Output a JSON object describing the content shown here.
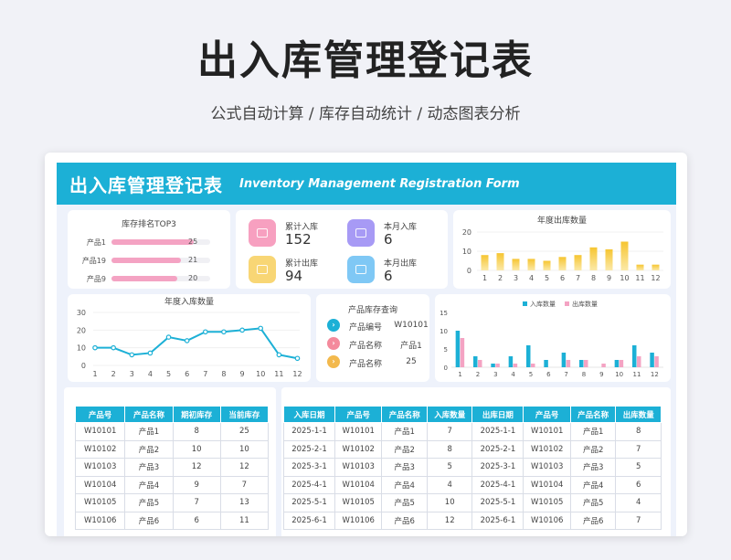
{
  "hero": {
    "title": "出入库管理登记表",
    "subtitle": "公式自动计算 /  库存自动统计  /  动态图表分析"
  },
  "banner": {
    "title_cn": "出入库管理登记表",
    "title_en": "Inventory Management Registration Form"
  },
  "colors": {
    "accent": "#1cb0d6",
    "pink": "#f4a3c3",
    "yellow": "#f6c531",
    "purple": "#a79af5",
    "blue": "#7fc8f5",
    "pink_icon": "#f7a0c0",
    "yellow_icon": "#f8d675"
  },
  "top3": {
    "title": "库存排名TOP3",
    "items": [
      {
        "label": "产品1",
        "value": 25
      },
      {
        "label": "产品19",
        "value": 21
      },
      {
        "label": "产品9",
        "value": 20
      }
    ]
  },
  "stats": {
    "total_in": {
      "label": "累计入库",
      "value": "152",
      "icon": "inbox-icon"
    },
    "month_in": {
      "label": "本月入库",
      "value": "6",
      "icon": "inbox-icon"
    },
    "total_out": {
      "label": "累计出库",
      "value": "94",
      "icon": "outbox-icon"
    },
    "month_out": {
      "label": "本月出库",
      "value": "6",
      "icon": "outbox-icon"
    }
  },
  "query": {
    "title": "产品库存查询",
    "rows": [
      {
        "label": "产品编号",
        "value": "W10101",
        "icon": "chevron-right-icon"
      },
      {
        "label": "产品名称",
        "value": "产品1",
        "icon": "chevron-right-icon"
      },
      {
        "label": "产品名称",
        "value": "25",
        "icon": "chevron-right-icon"
      }
    ]
  },
  "chart_data": [
    {
      "type": "bar",
      "title": "年度出库数量",
      "categories": [
        "1",
        "2",
        "3",
        "4",
        "5",
        "6",
        "7",
        "8",
        "9",
        "10",
        "11",
        "12"
      ],
      "values": [
        8,
        9,
        6,
        6,
        5,
        7,
        8,
        12,
        11,
        15,
        3,
        3
      ],
      "ylim": [
        0,
        20
      ],
      "yticks": [
        0,
        10,
        20
      ],
      "grid": true
    },
    {
      "type": "line",
      "title": "年度入库数量",
      "categories": [
        "1",
        "2",
        "3",
        "4",
        "5",
        "6",
        "7",
        "8",
        "9",
        "10",
        "11",
        "12"
      ],
      "values": [
        10,
        10,
        6,
        7,
        16,
        14,
        19,
        19,
        20,
        21,
        6,
        4
      ],
      "ylim": [
        0,
        30
      ],
      "yticks": [
        0,
        10,
        20,
        30
      ],
      "grid": true
    },
    {
      "type": "bar",
      "title": "",
      "categories": [
        "1",
        "2",
        "3",
        "4",
        "5",
        "6",
        "7",
        "8",
        "9",
        "10",
        "11",
        "12"
      ],
      "series": [
        {
          "name": "入库数量",
          "values": [
            10,
            3,
            1,
            3,
            6,
            2,
            4,
            2,
            0,
            2,
            6,
            4
          ]
        },
        {
          "name": "出库数量",
          "values": [
            8,
            2,
            1,
            1,
            1,
            0,
            2,
            2,
            1,
            2,
            3,
            3
          ]
        }
      ],
      "ylim": [
        0,
        15
      ],
      "yticks": [
        0,
        5,
        10,
        15
      ],
      "legend": "top-center",
      "grid": false
    }
  ],
  "stock_table": {
    "headers": [
      "产品号",
      "产品名称",
      "期初库存",
      "当前库存"
    ],
    "rows": [
      [
        "W10101",
        "产品1",
        "8",
        "25"
      ],
      [
        "W10102",
        "产品2",
        "10",
        "10"
      ],
      [
        "W10103",
        "产品3",
        "12",
        "12"
      ],
      [
        "W10104",
        "产品4",
        "9",
        "7"
      ],
      [
        "W10105",
        "产品5",
        "7",
        "13"
      ],
      [
        "W10106",
        "产品6",
        "6",
        "11"
      ]
    ]
  },
  "log_table": {
    "headers": [
      "入库日期",
      "产品号",
      "产品名称",
      "入库数量",
      "出库日期",
      "产品号",
      "产品名称",
      "出库数量"
    ],
    "rows": [
      [
        "2025-1-1",
        "W10101",
        "产品1",
        "7",
        "2025-1-1",
        "W10101",
        "产品1",
        "8"
      ],
      [
        "2025-2-1",
        "W10102",
        "产品2",
        "8",
        "2025-2-1",
        "W10102",
        "产品2",
        "7"
      ],
      [
        "2025-3-1",
        "W10103",
        "产品3",
        "5",
        "2025-3-1",
        "W10103",
        "产品3",
        "5"
      ],
      [
        "2025-4-1",
        "W10104",
        "产品4",
        "4",
        "2025-4-1",
        "W10104",
        "产品4",
        "6"
      ],
      [
        "2025-5-1",
        "W10105",
        "产品5",
        "10",
        "2025-5-1",
        "W10105",
        "产品5",
        "4"
      ],
      [
        "2025-6-1",
        "W10106",
        "产品6",
        "12",
        "2025-6-1",
        "W10106",
        "产品6",
        "7"
      ]
    ]
  }
}
